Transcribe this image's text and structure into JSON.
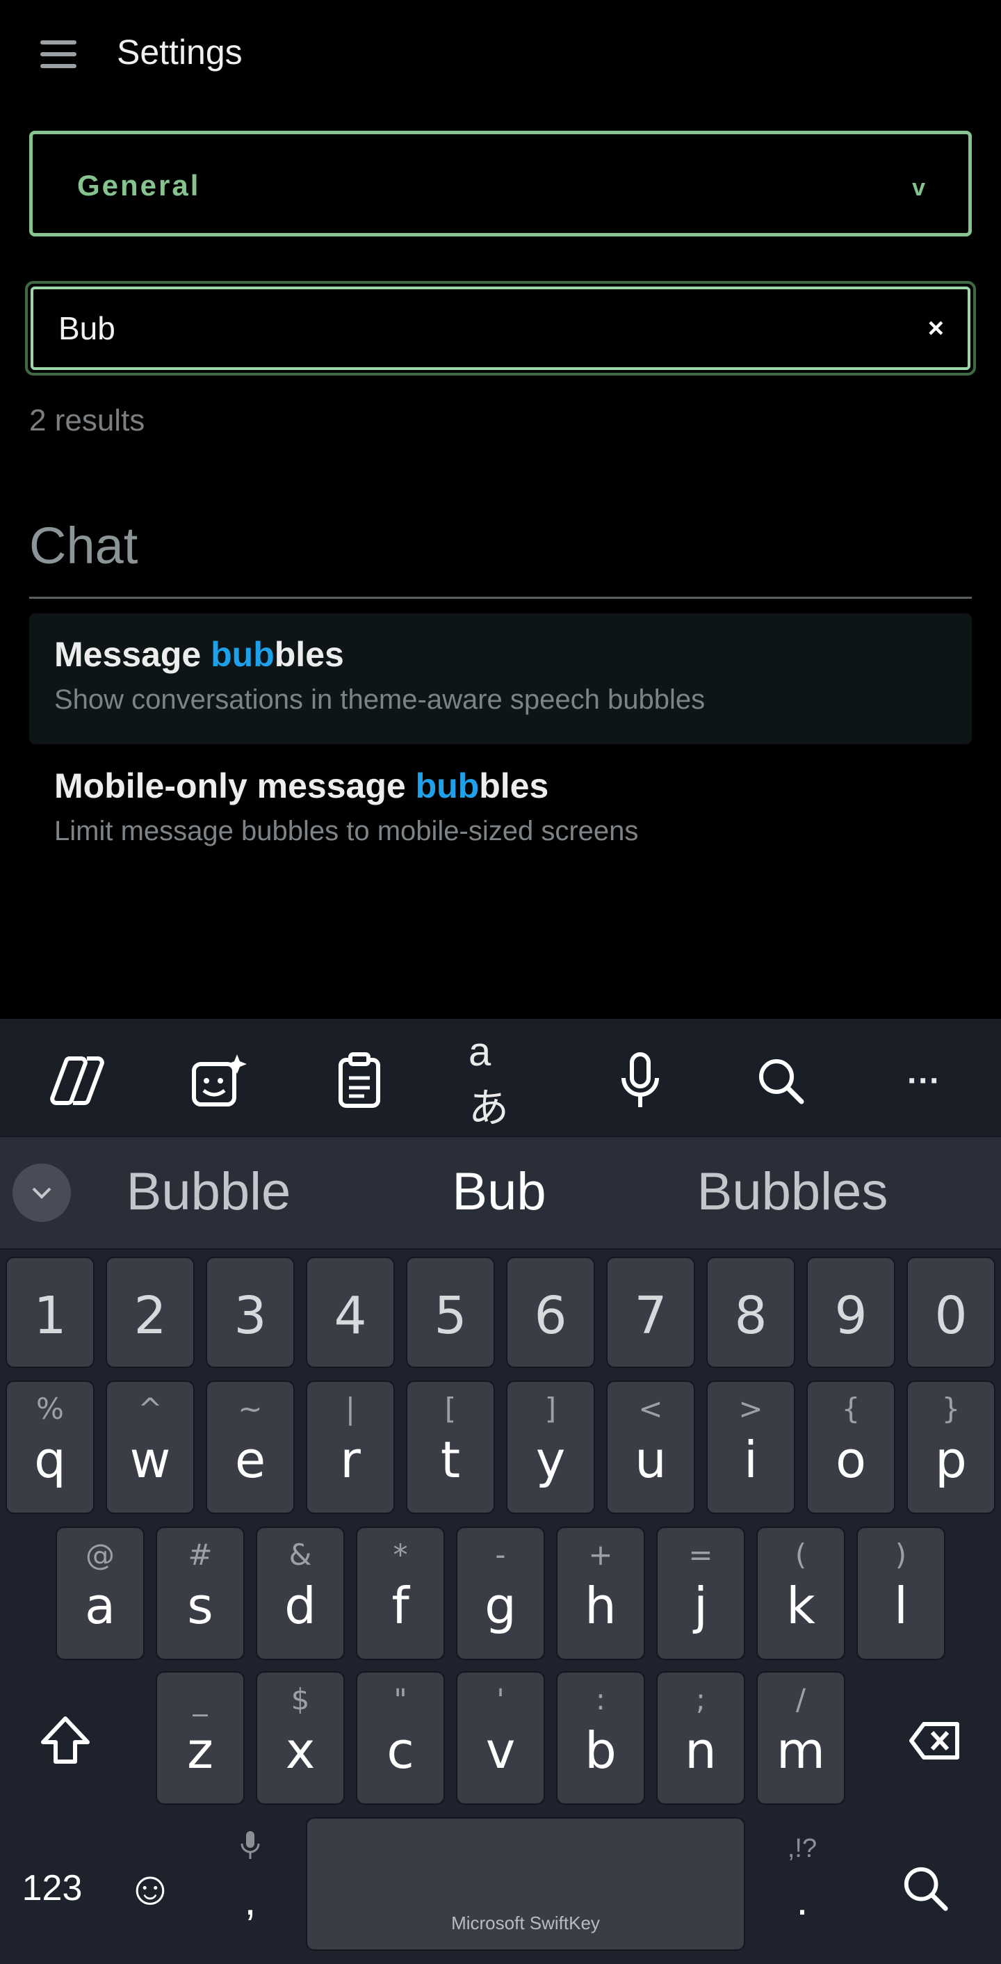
{
  "header": {
    "title": "Settings",
    "menu_icon": "hamburger-icon"
  },
  "category_select": {
    "value": "General",
    "chevron": "v"
  },
  "search": {
    "value": "Bub",
    "clear": "×"
  },
  "results_count": "2 results",
  "section": {
    "title": "Chat"
  },
  "results": [
    {
      "title_pre": "Message ",
      "title_match": "bub",
      "title_post": "bles",
      "description": "Show conversations in theme-aware speech bubbles",
      "highlighted": true
    },
    {
      "title_pre": "Mobile-only message ",
      "title_match": "bub",
      "title_post": "bles",
      "description": "Limit message bubbles to mobile-sized screens",
      "highlighted": false
    }
  ],
  "keyboard": {
    "toolbar_icons": [
      "copilot-icon",
      "sticker-sparkle-icon",
      "clipboard-icon",
      "translate-icon",
      "microphone-icon",
      "search-icon",
      "more-icon"
    ],
    "more_label": "···",
    "translate_label": "aあ",
    "suggestions": [
      "Bubble",
      "Bub",
      "Bubbles"
    ],
    "numbers": [
      "1",
      "2",
      "3",
      "4",
      "5",
      "6",
      "7",
      "8",
      "9",
      "0"
    ],
    "row1": [
      {
        "k": "q",
        "a": "%"
      },
      {
        "k": "w",
        "a": "^"
      },
      {
        "k": "e",
        "a": "~"
      },
      {
        "k": "r",
        "a": "|"
      },
      {
        "k": "t",
        "a": "["
      },
      {
        "k": "y",
        "a": "]"
      },
      {
        "k": "u",
        "a": "<"
      },
      {
        "k": "i",
        "a": ">"
      },
      {
        "k": "o",
        "a": "{"
      },
      {
        "k": "p",
        "a": "}"
      }
    ],
    "row2": [
      {
        "k": "a",
        "a": "@"
      },
      {
        "k": "s",
        "a": "#"
      },
      {
        "k": "d",
        "a": "&"
      },
      {
        "k": "f",
        "a": "*"
      },
      {
        "k": "g",
        "a": "-"
      },
      {
        "k": "h",
        "a": "+"
      },
      {
        "k": "j",
        "a": "="
      },
      {
        "k": "k",
        "a": "("
      },
      {
        "k": "l",
        "a": ")"
      }
    ],
    "row3": [
      {
        "k": "z",
        "a": "_"
      },
      {
        "k": "x",
        "a": "$"
      },
      {
        "k": "c",
        "a": "\""
      },
      {
        "k": "v",
        "a": "'"
      },
      {
        "k": "b",
        "a": ":"
      },
      {
        "k": "n",
        "a": ";"
      },
      {
        "k": "m",
        "a": "/"
      }
    ],
    "bottom": {
      "numbers_label": "123",
      "emoji": "☺",
      "comma": ",",
      "period": ".",
      "punct_hint": ",!?",
      "space_brand": "Microsoft SwiftKey"
    }
  }
}
